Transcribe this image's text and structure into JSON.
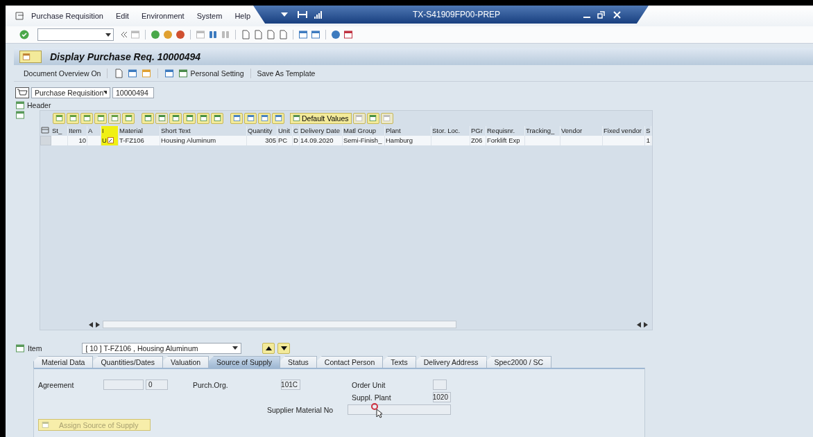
{
  "menu_bar": {
    "items": [
      "Purchase Requisition",
      "Edit",
      "Environment",
      "System",
      "Help"
    ]
  },
  "window": {
    "title": "TX-S41909FP00-PREP"
  },
  "screen_title": "Display Purchase Req. 10000494",
  "app_toolbar": {
    "document_overview": "Document Overview On",
    "personal_setting": "Personal Setting",
    "save_template": "Save As Template"
  },
  "document": {
    "type": "Purchase Requisition",
    "number": "10000494"
  },
  "header": {
    "label": "Header"
  },
  "grid_toolbar": {
    "default_values": "Default Values"
  },
  "table": {
    "columns": [
      "St_",
      "Item",
      "A",
      "I",
      "Material",
      "Short Text",
      "Quantity",
      "Unit",
      "C",
      "Delivery Date",
      "Matl Group",
      "Plant",
      "Stor. Loc.",
      "PGr",
      "Requisnr.",
      "Tracking_",
      "Vendor",
      "Fixed vendor",
      "S"
    ],
    "rows": [
      {
        "cells": [
          "",
          "10",
          "",
          "U",
          "T-FZ106",
          "Housing Aluminum",
          "305",
          "PC",
          "D",
          "14.09.2020",
          "Semi-Finish_",
          "Hamburg",
          "",
          "Z06",
          "Forklift Exp",
          "",
          "",
          "",
          "1"
        ],
        "highlighted": true
      }
    ]
  },
  "item": {
    "label": "Item",
    "value": "[ 10 ] T-FZ106 , Housing Aluminum"
  },
  "tabs": [
    {
      "label": "Material Data",
      "selected": false
    },
    {
      "label": "Quantities/Dates",
      "selected": false
    },
    {
      "label": "Valuation",
      "selected": false
    },
    {
      "label": "Source of Supply",
      "selected": true
    },
    {
      "label": "Status",
      "selected": false
    },
    {
      "label": "Contact Person",
      "selected": false
    },
    {
      "label": "Texts",
      "selected": false
    },
    {
      "label": "Delivery Address",
      "selected": false
    },
    {
      "label": "Spec2000 / SC",
      "selected": false
    }
  ],
  "source_of_supply": {
    "agreement": {
      "label": "Agreement",
      "item": "0"
    },
    "purch_org": {
      "label": "Purch.Org.",
      "value": "101C"
    },
    "order_unit": {
      "label": "Order Unit"
    },
    "suppl_plant": {
      "label": "Suppl. Plant",
      "value": "1020"
    },
    "supplier_material": {
      "label": "Supplier Material No"
    },
    "assign_button": {
      "label": "Assign Source of Supply",
      "disabled": true
    }
  }
}
